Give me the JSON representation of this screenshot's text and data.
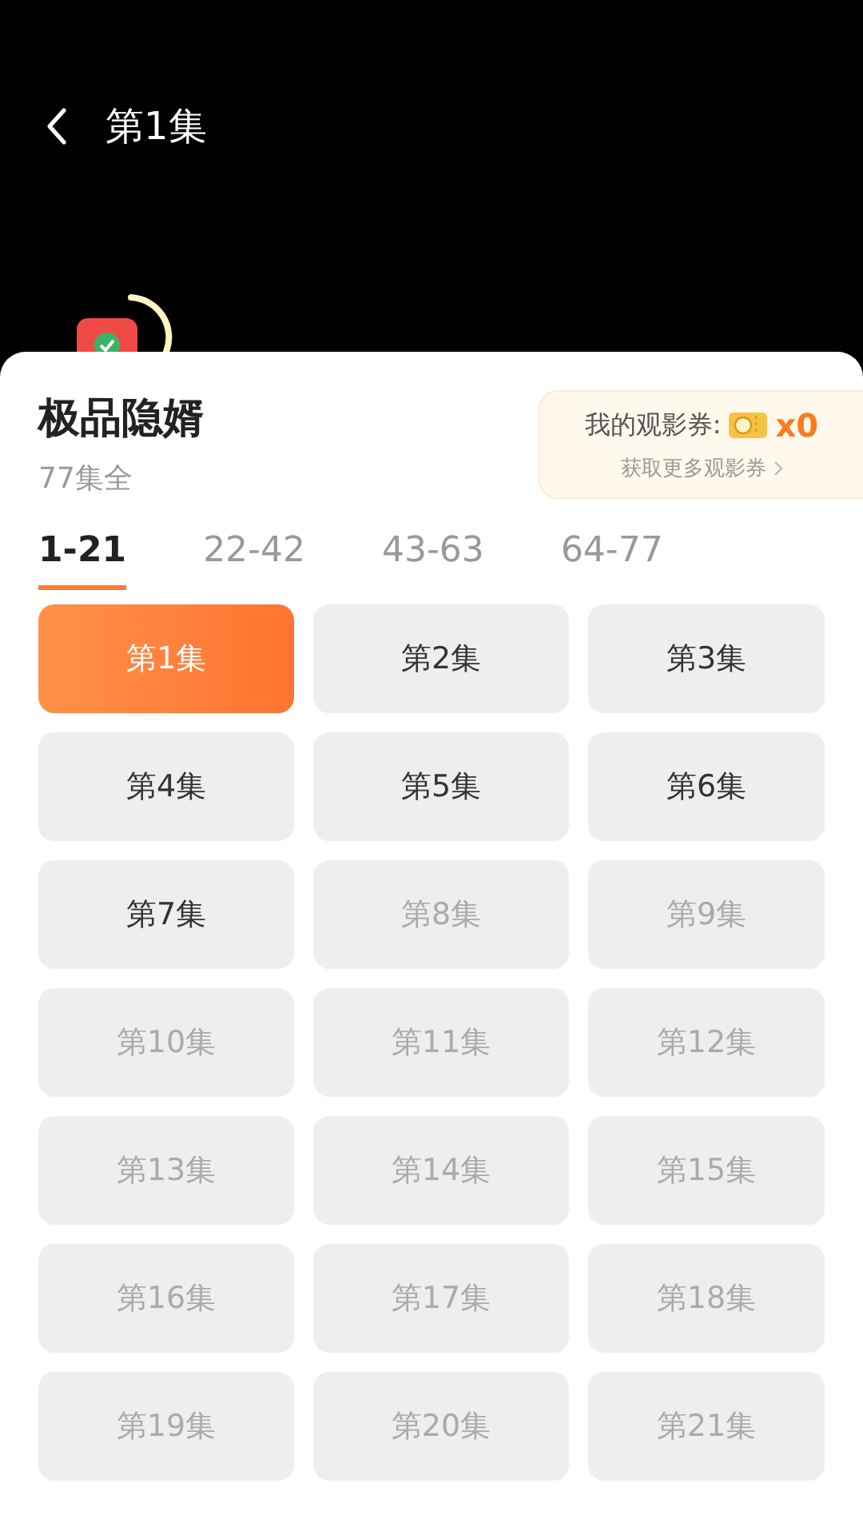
{
  "top_bar": {
    "title": "第1集"
  },
  "drama": {
    "title": "极品隐婿",
    "episode_count": "77集全"
  },
  "voucher": {
    "label": "我的观影券:",
    "count": "x0",
    "link": "获取更多观影券"
  },
  "ranges": [
    {
      "label": "1-21",
      "selected": true
    },
    {
      "label": "22-42",
      "selected": false
    },
    {
      "label": "43-63",
      "selected": false
    },
    {
      "label": "64-77",
      "selected": false
    }
  ],
  "episodes": [
    {
      "label": "第1集",
      "selected": true,
      "locked": false
    },
    {
      "label": "第2集",
      "selected": false,
      "locked": false
    },
    {
      "label": "第3集",
      "selected": false,
      "locked": false
    },
    {
      "label": "第4集",
      "selected": false,
      "locked": false
    },
    {
      "label": "第5集",
      "selected": false,
      "locked": false
    },
    {
      "label": "第6集",
      "selected": false,
      "locked": false
    },
    {
      "label": "第7集",
      "selected": false,
      "locked": false
    },
    {
      "label": "第8集",
      "selected": false,
      "locked": true
    },
    {
      "label": "第9集",
      "selected": false,
      "locked": true
    },
    {
      "label": "第10集",
      "selected": false,
      "locked": true
    },
    {
      "label": "第11集",
      "selected": false,
      "locked": true
    },
    {
      "label": "第12集",
      "selected": false,
      "locked": true
    },
    {
      "label": "第13集",
      "selected": false,
      "locked": true
    },
    {
      "label": "第14集",
      "selected": false,
      "locked": true
    },
    {
      "label": "第15集",
      "selected": false,
      "locked": true
    },
    {
      "label": "第16集",
      "selected": false,
      "locked": true
    },
    {
      "label": "第17集",
      "selected": false,
      "locked": true
    },
    {
      "label": "第18集",
      "selected": false,
      "locked": true
    },
    {
      "label": "第19集",
      "selected": false,
      "locked": true
    },
    {
      "label": "第20集",
      "selected": false,
      "locked": true
    },
    {
      "label": "第21集",
      "selected": false,
      "locked": true
    }
  ]
}
